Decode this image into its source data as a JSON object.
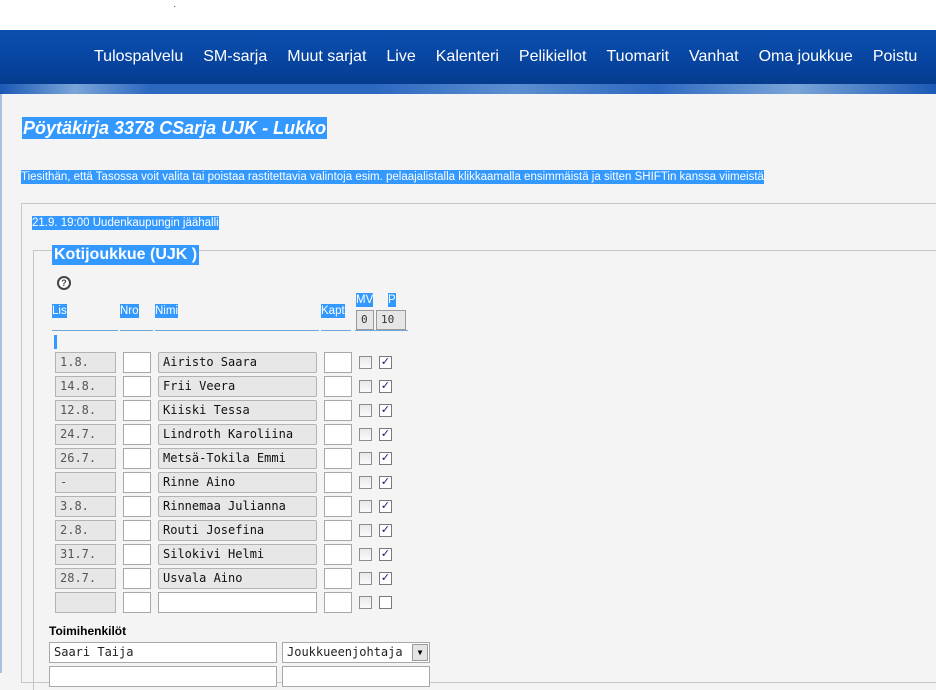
{
  "nav": {
    "items": [
      "Tulospalvelu",
      "SM-sarja",
      "Muut sarjat",
      "Live",
      "Kalenteri",
      "Pelikiellot",
      "Tuomarit",
      "Vanhat",
      "Oma joukkue",
      "Poistu"
    ]
  },
  "page": {
    "title": "Pöytäkirja 3378 CSarja UJK - Lukko",
    "tip": "Tiesithän, että Tasossa voit valita tai poistaa rastitettavia valintoja esim. pelaajalistalla klikkaamalla ensimmäistä ja sitten SHIFTin kanssa viimeistä"
  },
  "match": {
    "datetime_venue": "21.9. 19:00 Uudenkaupungin jäähalli"
  },
  "home_team": {
    "legend": "Kotijoukkue (UJK )",
    "help_icon": "help-icon",
    "columns": {
      "lis": "Lis",
      "nro": "Nro",
      "nimi": "Nimi",
      "kapt": "Kapt",
      "mv": "MV",
      "p": "P"
    },
    "counts": {
      "mv": "0",
      "p": "10"
    },
    "players": [
      {
        "lis": "1.8.",
        "nro": "",
        "name": "Airisto Saara",
        "kapt": "",
        "mv": false,
        "p": true
      },
      {
        "lis": "14.8.",
        "nro": "",
        "name": "Frii Veera",
        "kapt": "",
        "mv": false,
        "p": true
      },
      {
        "lis": "12.8.",
        "nro": "",
        "name": "Kiiski Tessa",
        "kapt": "",
        "mv": false,
        "p": true
      },
      {
        "lis": "24.7.",
        "nro": "",
        "name": "Lindroth Karoliina",
        "kapt": "",
        "mv": false,
        "p": true
      },
      {
        "lis": "26.7.",
        "nro": "",
        "name": "Metsä-Tokila Emmi",
        "kapt": "",
        "mv": false,
        "p": true
      },
      {
        "lis": "-",
        "nro": "",
        "name": "Rinne Aino",
        "kapt": "",
        "mv": false,
        "p": true
      },
      {
        "lis": "3.8.",
        "nro": "",
        "name": "Rinnemaa Julianna",
        "kapt": "",
        "mv": false,
        "p": true
      },
      {
        "lis": "2.8.",
        "nro": "",
        "name": "Routi Josefina",
        "kapt": "",
        "mv": false,
        "p": true
      },
      {
        "lis": "31.7.",
        "nro": "",
        "name": "Silokivi Helmi",
        "kapt": "",
        "mv": false,
        "p": true
      },
      {
        "lis": "28.7.",
        "nro": "",
        "name": "Usvala Aino",
        "kapt": "",
        "mv": false,
        "p": true
      },
      {
        "lis": "",
        "nro": "",
        "name": "",
        "kapt": "",
        "mv": false,
        "p": false
      }
    ]
  },
  "staff": {
    "title": "Toimihenkilöt",
    "rows": [
      {
        "name": "Saari Taija",
        "role": "Joukkueenjohtaja"
      }
    ]
  }
}
